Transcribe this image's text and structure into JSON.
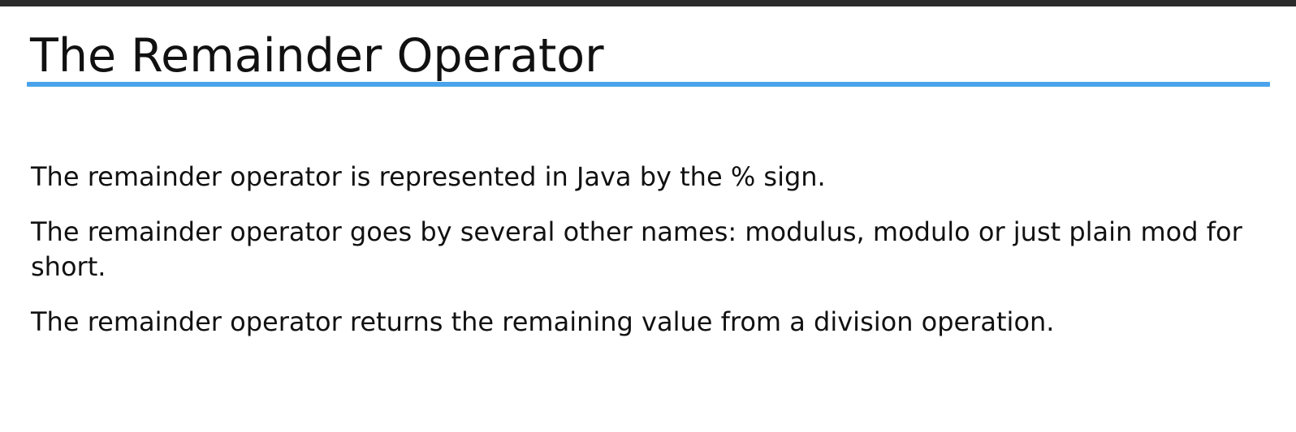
{
  "slide": {
    "title": "The Remainder Operator",
    "paragraphs": [
      "The remainder operator is represented in Java by the % sign.",
      "The remainder operator goes by several other names: modulus, modulo or just plain mod for short.",
      "The remainder operator returns the remaining value from a division operation."
    ]
  },
  "colors": {
    "accent_rule": "#4aa3eb",
    "top_bar": "#2b2b2b",
    "text": "#111111",
    "background": "#ffffff"
  }
}
